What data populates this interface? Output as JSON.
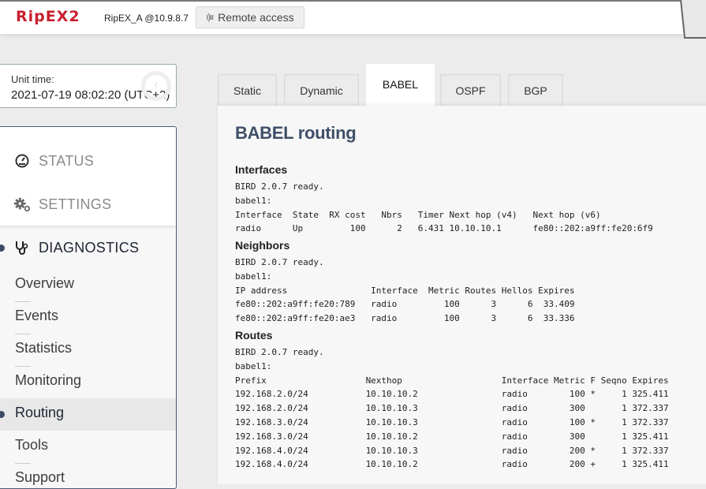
{
  "header": {
    "logo": "RipEX2",
    "unit_name": "RipEX_A @10.9.8.7",
    "remote_access_label": "Remote access",
    "remote_access_icon": "antenna-icon"
  },
  "unit_time": {
    "label": "Unit time:",
    "value": "2021-07-19 08:02:20 (UTC+2)"
  },
  "sidebar": {
    "main_items": [
      {
        "label": "STATUS",
        "icon": "gauge-icon",
        "active": false
      },
      {
        "label": "SETTINGS",
        "icon": "gears-icon",
        "active": false
      },
      {
        "label": "DIAGNOSTICS",
        "icon": "stethoscope-icon",
        "active": true
      }
    ],
    "sub_items": [
      {
        "label": "Overview",
        "active": false
      },
      {
        "label": "Events",
        "active": false
      },
      {
        "label": "Statistics",
        "active": false
      },
      {
        "label": "Monitoring",
        "active": false
      },
      {
        "label": "Routing",
        "active": true
      },
      {
        "label": "Tools",
        "active": false
      },
      {
        "label": "Support",
        "active": false
      }
    ]
  },
  "tabs": [
    {
      "label": "Static",
      "active": false
    },
    {
      "label": "Dynamic",
      "active": false
    },
    {
      "label": "BABEL",
      "active": true
    },
    {
      "label": "OSPF",
      "active": false
    },
    {
      "label": "BGP",
      "active": false
    }
  ],
  "main": {
    "title": "BABEL routing",
    "sections": {
      "interfaces": {
        "title": "Interfaces",
        "output": "BIRD 2.0.7 ready.\nbabel1:\nInterface  State  RX cost   Nbrs   Timer Next hop (v4)   Next hop (v6)\nradio      Up         100      2   6.431 10.10.10.1      fe80::202:a9ff:fe20:6f9"
      },
      "neighbors": {
        "title": "Neighbors",
        "output": "BIRD 2.0.7 ready.\nbabel1:\nIP address                Interface  Metric Routes Hellos Expires\nfe80::202:a9ff:fe20:789   radio         100      3      6  33.409\nfe80::202:a9ff:fe20:ae3   radio         100      3      6  33.336"
      },
      "routes": {
        "title": "Routes",
        "output": "BIRD 2.0.7 ready.\nbabel1:\nPrefix                   Nexthop                   Interface Metric F Seqno Expires\n192.168.2.0/24           10.10.10.2                radio        100 *     1 325.411\n192.168.2.0/24           10.10.10.3                radio        300       1 372.337\n192.168.3.0/24           10.10.10.3                radio        100 *     1 372.337\n192.168.3.0/24           10.10.10.2                radio        300       1 325.411\n192.168.4.0/24           10.10.10.3                radio        200 *     1 372.337\n192.168.4.0/24           10.10.10.2                radio        200 +     1 325.411"
      }
    }
  },
  "colors": {
    "brand_red": "#c8202f",
    "title_blue": "#3f4f68",
    "sidebar_border": "#4a5a75"
  }
}
